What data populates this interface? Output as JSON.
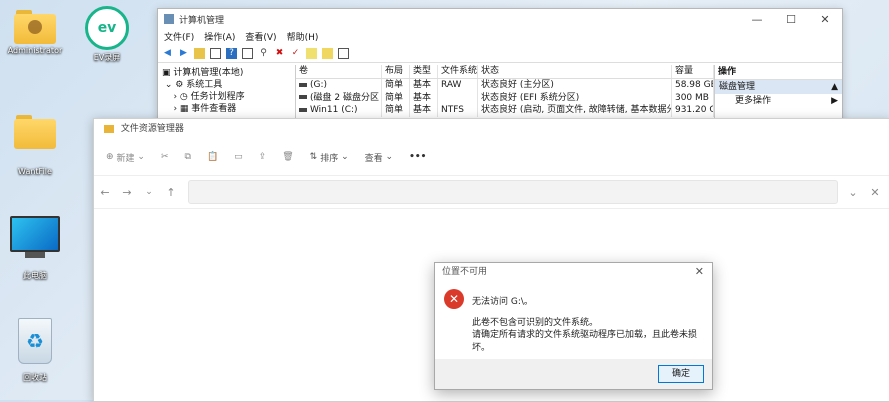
{
  "desktop": {
    "icons": [
      {
        "label": "Administrator"
      },
      {
        "label": "EV录屏"
      },
      {
        "label": "WantFile"
      },
      {
        "label": "此电脑"
      },
      {
        "label": "回收站"
      }
    ]
  },
  "comp_mgmt": {
    "title": "计算机管理",
    "menu": [
      "文件(F)",
      "操作(A)",
      "查看(V)",
      "帮助(H)"
    ],
    "tree": [
      "计算机管理(本地)",
      "系统工具",
      "任务计划程序",
      "事件查看器"
    ],
    "columns": [
      "卷",
      "布局",
      "类型",
      "文件系统",
      "状态",
      "容量"
    ],
    "rows": [
      [
        "(G:)",
        "简单",
        "基本",
        "RAW",
        "状态良好 (主分区)",
        "58.98 GE"
      ],
      [
        "(磁盘 2 磁盘分区 1)",
        "简单",
        "基本",
        "",
        "状态良好 (EFI 系统分区)",
        "300 MB"
      ],
      [
        "Win11 (C:)",
        "简单",
        "基本",
        "NTFS",
        "状态良好 (启动, 页面文件, 故障转储, 基本数据分区)",
        "931.20 G"
      ]
    ],
    "actions": {
      "header": "操作",
      "selected": "磁盘管理",
      "more": "更多操作"
    }
  },
  "explorer": {
    "title": "文件资源管理器",
    "toolbar": {
      "new": "新建",
      "sort": "排序",
      "view": "查看",
      "more": "•••"
    }
  },
  "dialog": {
    "title": "位置不可用",
    "line1": "无法访问 G:\\。",
    "line2": "此卷不包含可识别的文件系统。",
    "line3": "请确定所有请求的文件系统驱动程序已加载，且此卷未损坏。",
    "ok": "确定"
  }
}
